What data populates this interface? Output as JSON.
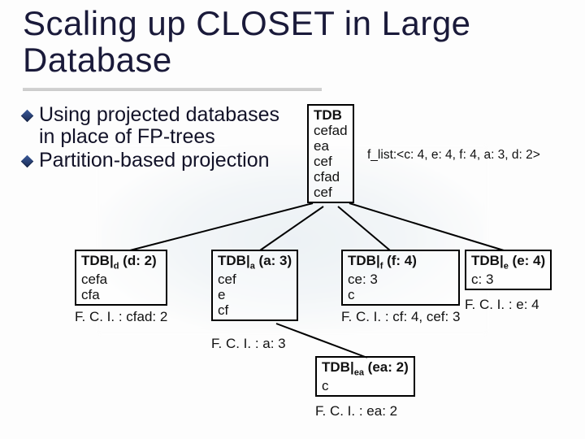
{
  "title": "Scaling up CLOSET in Large Database",
  "bullets": [
    "Using projected databases in place of FP-trees",
    "Partition-based projection"
  ],
  "flist": "f_list:<c: 4, e: 4, f: 4, a: 3, d: 2>",
  "root": {
    "header": "TDB",
    "rows": [
      "cefad",
      "ea",
      "cef",
      "cfad",
      "cef"
    ]
  },
  "children": {
    "d": {
      "header": "TDB|d (d: 2)",
      "header_plain": "TDB|",
      "header_sub": "d",
      "header_tail": " (d: 2)",
      "rows": [
        "cefa",
        "cfa"
      ],
      "fci": "F. C. I. : cfad: 2"
    },
    "a": {
      "header_plain": "TDB|",
      "header_sub": "a",
      "header_tail": " (a: 3)",
      "rows": [
        "cef",
        "e",
        "cf"
      ],
      "fci": "F. C. I. : a: 3"
    },
    "f": {
      "header_plain": "TDB|",
      "header_sub": "f",
      "header_tail": " (f: 4)",
      "rows": [
        "ce: 3",
        "c"
      ],
      "fci": "F. C. I. : cf: 4, cef: 3"
    },
    "e": {
      "header_plain": "TDB|",
      "header_sub": "e",
      "header_tail": " (e: 4)",
      "rows": [
        "c: 3"
      ],
      "fci": "F. C. I. : e: 4"
    }
  },
  "grandchild": {
    "ea": {
      "header_plain": "TDB|",
      "header_sub": "ea",
      "header_tail": " (ea: 2)",
      "rows": [
        "c"
      ],
      "fci": "F. C. I. : ea: 2"
    }
  }
}
